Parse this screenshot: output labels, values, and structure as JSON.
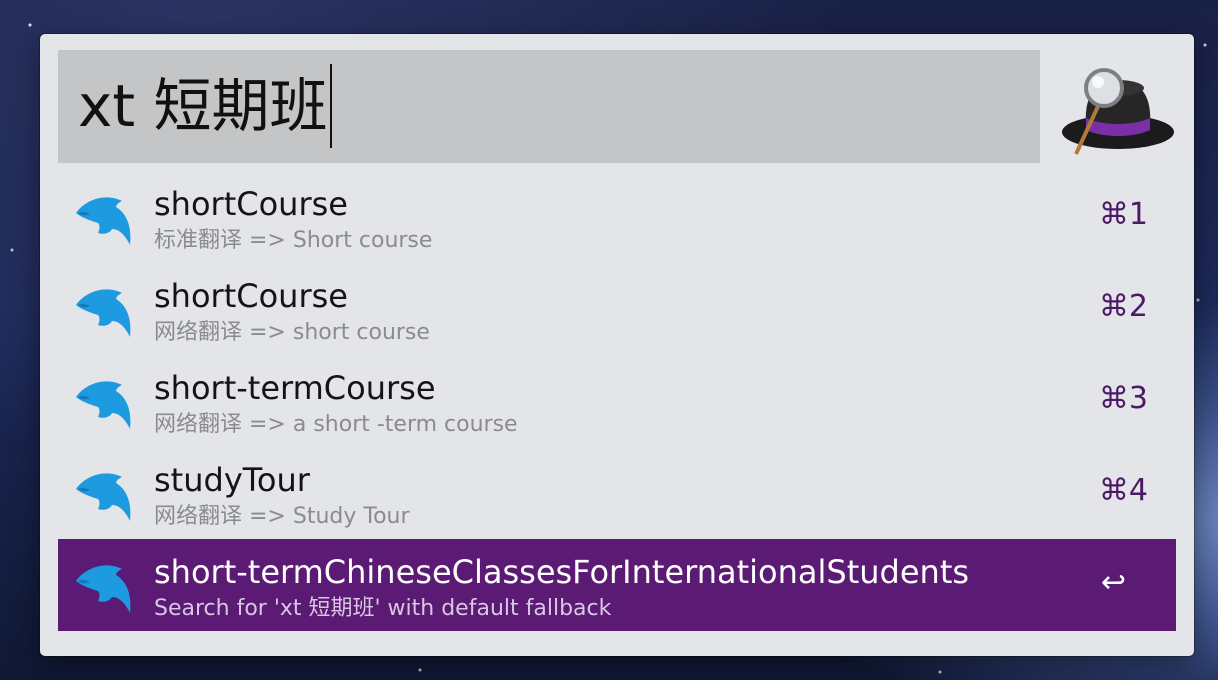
{
  "search": {
    "query": "xt 短期班"
  },
  "results": [
    {
      "title": "shortCourse",
      "subtitle": "标准翻译 => Short course",
      "shortcut": "⌘1"
    },
    {
      "title": "shortCourse",
      "subtitle": "网络翻译 => short course",
      "shortcut": "⌘2"
    },
    {
      "title": "short-termCourse",
      "subtitle": "网络翻译 => a short -term course",
      "shortcut": "⌘3"
    },
    {
      "title": "studyTour",
      "subtitle": "网络翻译 => Study Tour",
      "shortcut": "⌘4"
    },
    {
      "title": "short-termChineseClassesForInternationalStudents",
      "subtitle": "Search for 'xt 短期班' with default fallback",
      "shortcut": "↩"
    }
  ],
  "colors": {
    "accent": "#5b1a74",
    "dolphin": "#1d9ae0",
    "shortcut": "#4b1a66"
  },
  "icons": {
    "app": "alfred-hat-icon",
    "result": "dolphin-icon"
  }
}
